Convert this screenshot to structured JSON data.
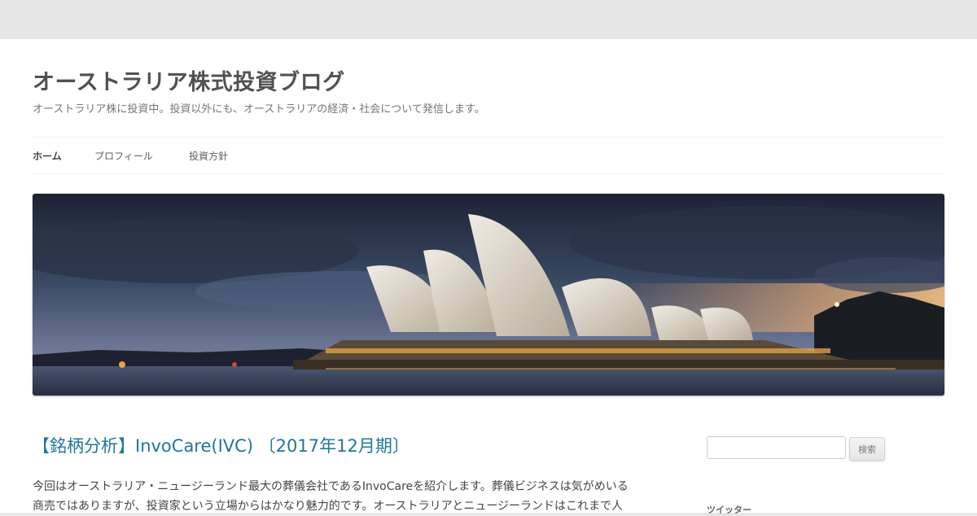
{
  "site": {
    "title": "オーストラリア株式投資ブログ",
    "description": "オーストラリア株に投資中。投資以外にも、オーストラリアの経済・社会について発信します。"
  },
  "nav": {
    "items": [
      {
        "label": "ホーム"
      },
      {
        "label": "プロフィール"
      },
      {
        "label": "投資方針"
      }
    ]
  },
  "header_image": {
    "subject": "Sydney Opera House at dusk"
  },
  "post": {
    "title": "【銘柄分析】InvoCare(IVC) 〔2017年12月期〕",
    "content": "今回はオーストラリア・ニュージーランド最大の葬儀会社であるInvoCareを紹介します。葬儀ビジネスは気がめいる商売ではありますが、投資家という立場からはかなり魅力的です。オーストラリアとニュージーランドはこれまで人"
  },
  "sidebar": {
    "search": {
      "placeholder": "",
      "button_label": "検索"
    },
    "widget_title": "ツイッター"
  },
  "colors": {
    "link": "#21759b",
    "background": "#e6e6e6"
  }
}
